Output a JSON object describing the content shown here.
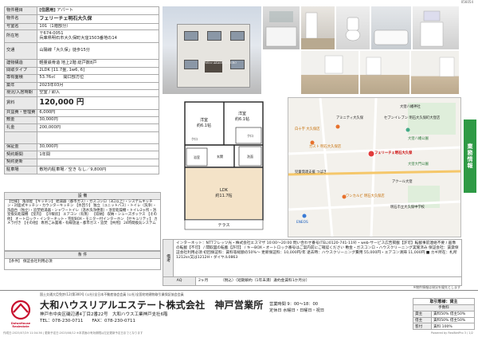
{
  "id_code": "056054",
  "spec": {
    "type_tag": "[住居用]",
    "property_type": "アパート",
    "rows": [
      {
        "key": "物件名",
        "value": "フェリーチェ明石大久保",
        "cls": "h9 title"
      },
      {
        "key": "号室名",
        "value": "101（1階部分）",
        "cls": "h7"
      },
      {
        "key": "所在地",
        "value": "〒674-0051\n兵庫県明石市大久保町大窪1503番地の14",
        "cls": "h14"
      },
      {
        "key": "交通",
        "value": "山陽線「大久保」徒歩15分",
        "cls": "h21"
      },
      {
        "key": "建物構造",
        "value": "軽量鉄骨造 地上2階 総戸数8戸",
        "cls": "h8"
      },
      {
        "key": "間取タイプ",
        "value": "2LDK [11.7畳, 1w6, 6]",
        "cls": "h8"
      },
      {
        "key": "専有面積",
        "value": "53.76㎡",
        "value2": "開口部方位",
        "cls": "h8"
      },
      {
        "key": "築年",
        "value": "2023年03月",
        "cls": "h8"
      },
      {
        "key": "現況/入居時期",
        "value": "空室 / 即入",
        "cls": "h8"
      },
      {
        "key": "賃料",
        "value": "120,000 円",
        "cls": "h14 rent"
      },
      {
        "key": "共益費・管理費",
        "value": "6,000円",
        "cls": "h8"
      },
      {
        "key": "敷金",
        "value": "30,000円",
        "cls": "h8"
      },
      {
        "key": "礼金",
        "value": "200,000円",
        "cls": "h8"
      },
      {
        "key": "",
        "value": "",
        "cls": "h14"
      },
      {
        "key": "保証金",
        "value": "30,000円",
        "cls": "h8"
      },
      {
        "key": "契約期間",
        "value": "1年間",
        "cls": "h8"
      },
      {
        "key": "契約更新",
        "value": "",
        "cls": "h8"
      },
      {
        "key": "駐車場",
        "value": "敷地内駐車場／空き なし／9,800円",
        "cls": "h8"
      }
    ]
  },
  "equipment": {
    "header": "設 備",
    "text": "【仕様】 角部屋 【キッチン】 給湯器（都市ガス）・ガスコンロ（3口以上）・システムキッチン・対面式キッチン・カウンターキッチン 【水回り】 独立（ユニットバス）・トイレ（洗浄）・洗面台（独立）・追焚給湯器・シャワートイレ（温水洗浄便座）・浴室乾燥機・トイレ2ヶ所・浴室換気乾燥機 【室内】 【冷暖房】 エアコン（有無） 【収納】 収納・シューズボックス 【その他】 オートロック・インターネット・宅配BOX・モニター付インターホン 【セキュリティ】 カメラ付き 【その他】 専用ごみ置場・有線放送・都市ガス・追焚 【共用】 24時間換気システム"
  },
  "conditions": {
    "header": "条 件",
    "text": "【条件】 保証会社利用必須"
  },
  "plaque_text": "Felice AKASHI OKUBO",
  "plan": {
    "rooms": [
      "洋室",
      "洋室",
      "LDK"
    ],
    "room_sizes": [
      "約6.1帖",
      "約6.1帖",
      "約11.7帖"
    ],
    "terrace": "テラス",
    "labels": [
      "クロ",
      "クロ",
      "洗面",
      "浴室",
      "玄関"
    ]
  },
  "map": {
    "labels": [
      "大窪八幡神社",
      "セブンイレブン 明石大久保町大窪店",
      "白十字 大久保店",
      "ガスト 明石大久保店",
      "フェリーチェ明石大久保",
      "ワンカルビ 明石大久保店",
      "大窪大門公園",
      "ENEOS",
      "明石市立大久保中学校",
      "大窪八幡公園",
      "児童発達支援 つばき",
      "アミニティ大久保",
      "アクール大窪"
    ]
  },
  "side_tab": "業務情報",
  "remarks": {
    "label": "備考",
    "text": "インターネット：NTTフレッツ光・株式会社エスマザ 10:00〜20:00 問い合わせ番号(TEL)0120-741-119）・web-サービス広告掲載【許可】転載事前連絡不要 / 画像の転載【不可】 / 間取図の転載【許可】 / キーBOX・オートロック番号はご案内前にご確認ください 敷金・ガスコンロ・ハウスクリーニング実施済み 保証会社：賃貸保証会社利用必須 初回保証料：賃料等総額の50%〜 更新保証料：10,000円/年 退去時：ハウスクリーニング費用 55,000円・エアコン清掃 11,000円 ■ カギ所在：札所1212sn又は1212H・ダイヤル0863"
  },
  "aq": {
    "label": "AQ",
    "value": "2ヶ月",
    "note": "（税込）（短期解約（1年未満）違約金賃料1か月分）"
  },
  "small_note": "※物件情報は現況を優先とします",
  "footer": {
    "association": "国土交通大臣免許(12)第300号 (公社)全日本不動産協会会員 (公社)全国宅地建物取引業保証協会会員",
    "logo_text": "DaiwaHouse Realestate",
    "company": "大和ハウスリアルエステート株式会社　神戸営業所",
    "address": "神戸市中央区磯辺通4丁目2番22号　大和ハウス工業神戸支社6階",
    "tel": "TEL：078-230-0711　　FAX：078-230-0711",
    "hours1": "営業時間 9：00〜18：00",
    "hours2": "定休日 水曜日・日曜日・祝日",
    "deal_header": "取引態様：貸主",
    "deal_sub": "手数料",
    "deal_rows": [
      [
        "貸主",
        "賃料50% 借主50%"
      ],
      [
        "借主",
        "賃料50% 借主50%"
      ],
      [
        "客付",
        "賃料 100%"
      ]
    ],
    "stamp_left": "作成日:2025/07/29 11:04:36 | 更新予定日:2025/08/12 ※本書面の有効期限は左記更新予定日までとなります",
    "stamp_right": "Powered by RealNetPro 3 / 1/2"
  }
}
